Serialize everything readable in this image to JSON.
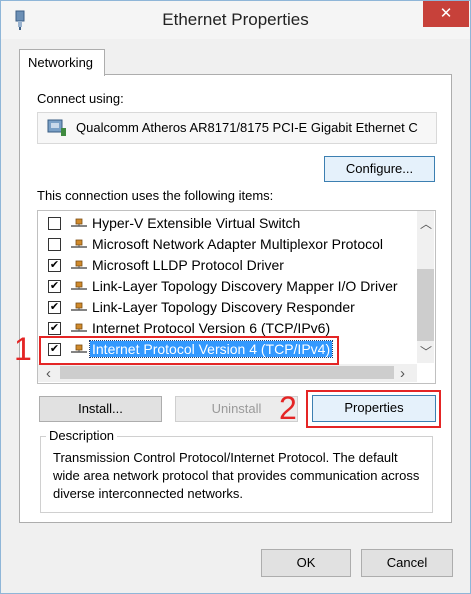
{
  "window": {
    "title": "Ethernet Properties",
    "close_glyph": "✕",
    "icon": "network-adapter-icon"
  },
  "tabs": [
    {
      "label": "Networking",
      "selected": true
    }
  ],
  "connect_using": {
    "label": "Connect using:",
    "adapter": "Qualcomm Atheros AR8171/8175 PCI-E Gigabit Ethernet C"
  },
  "configure_button": "Configure...",
  "items_label": "This connection uses the following items:",
  "items": [
    {
      "label": "Hyper-V Extensible Virtual Switch",
      "checked": false,
      "selected": false
    },
    {
      "label": "Microsoft Network Adapter Multiplexor Protocol",
      "checked": false,
      "selected": false
    },
    {
      "label": "Microsoft LLDP Protocol Driver",
      "checked": true,
      "selected": false
    },
    {
      "label": "Link-Layer Topology Discovery Mapper I/O Driver",
      "checked": true,
      "selected": false
    },
    {
      "label": "Link-Layer Topology Discovery Responder",
      "checked": true,
      "selected": false
    },
    {
      "label": "Internet Protocol Version 6 (TCP/IPv6)",
      "checked": true,
      "selected": false
    },
    {
      "label": "Internet Protocol Version 4 (TCP/IPv4)",
      "checked": true,
      "selected": true
    }
  ],
  "check_glyph": "✔",
  "buttons": {
    "install": "Install...",
    "uninstall": "Uninstall",
    "properties": "Properties",
    "ok": "OK",
    "cancel": "Cancel"
  },
  "description": {
    "legend": "Description",
    "text": "Transmission Control Protocol/Internet Protocol. The default wide area network protocol that provides communication across diverse interconnected networks."
  },
  "annotations": {
    "step1": "1",
    "step2": "2",
    "color": "#e42525"
  },
  "scroll_glyphs": {
    "up": "︿",
    "down": "﹀",
    "left": "‹",
    "right": "›"
  }
}
